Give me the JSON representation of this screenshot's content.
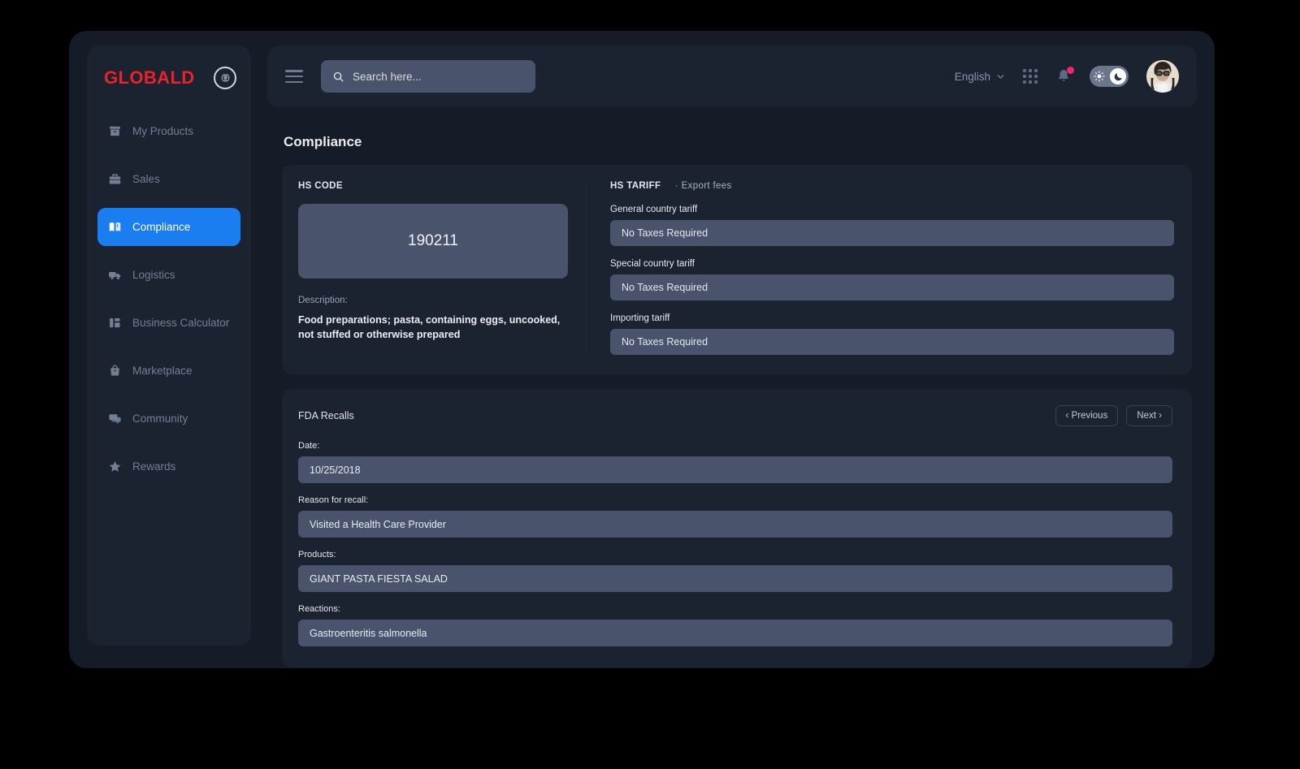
{
  "brand": {
    "name": "GLOBALD",
    "badge_icon": "brain-icon",
    "accent_color": "#e8242a"
  },
  "sidebar": {
    "items": [
      {
        "label": "My Products",
        "icon": "archive-box-icon",
        "active": false
      },
      {
        "label": "Sales",
        "icon": "briefcase-icon",
        "active": false
      },
      {
        "label": "Compliance",
        "icon": "open-book-icon",
        "active": true
      },
      {
        "label": "Logistics",
        "icon": "truck-icon",
        "active": false
      },
      {
        "label": "Business Calculator",
        "icon": "dashboard-blocks-icon",
        "active": false
      },
      {
        "label": "Marketplace",
        "icon": "shopping-bag-icon",
        "active": false
      },
      {
        "label": "Community",
        "icon": "chat-bubbles-icon",
        "active": false
      },
      {
        "label": "Rewards",
        "icon": "star-icon",
        "active": false
      }
    ],
    "active_color": "#1a7ef0"
  },
  "topbar": {
    "menu_icon": "hamburger-icon",
    "search": {
      "icon": "search-icon",
      "placeholder": "Search here...",
      "value": ""
    },
    "language": {
      "label": "English",
      "chevron_icon": "chevron-down-icon"
    },
    "apps_icon": "grid-dots-icon",
    "notifications": {
      "icon": "bell-icon",
      "has_unread": true,
      "badge_color": "#f0256f"
    },
    "theme_toggle": {
      "left_icon": "sun-icon",
      "right_icon": "moon-icon",
      "state": "dark"
    },
    "avatar": "user-avatar"
  },
  "page": {
    "title": "Compliance"
  },
  "hs_code": {
    "section_label": "HS CODE",
    "code": "190211",
    "description_label": "Description:",
    "description": "Food preparations; pasta, containing eggs, uncooked, not stuffed or otherwise prepared"
  },
  "hs_tariff": {
    "section_label": "HS TARIFF",
    "section_sub": "· Export fees",
    "fields": [
      {
        "label": "General country tariff",
        "value": "No Taxes Required"
      },
      {
        "label": "Special country tariff",
        "value": "No Taxes Required"
      },
      {
        "label": "Importing tariff",
        "value": "No Taxes Required"
      }
    ]
  },
  "fda_recalls": {
    "title": "FDA Recalls",
    "previous_label": "‹ Previous",
    "next_label": "Next ›",
    "fields": [
      {
        "label": "Date:",
        "value": "10/25/2018"
      },
      {
        "label": "Reason for recall:",
        "value": "Visited a Health Care Provider"
      },
      {
        "label": "Products:",
        "value": "GIANT PASTA FIESTA SALAD"
      },
      {
        "label": "Reactions:",
        "value": "Gastroenteritis salmonella"
      }
    ]
  }
}
